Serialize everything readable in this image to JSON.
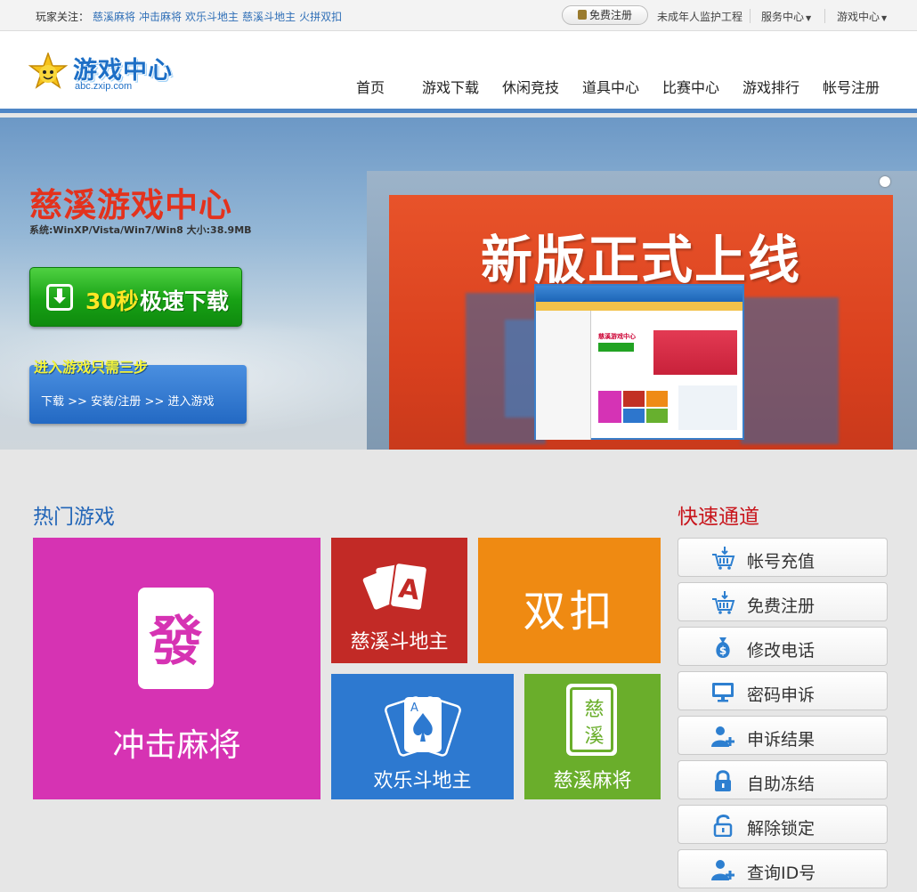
{
  "topbar": {
    "follow_label": "玩家关注：",
    "follow_links": [
      "慈溪麻将",
      "冲击麻将",
      "欢乐斗地主",
      "慈溪斗地主",
      "火拼双扣"
    ],
    "register_label": "免费注册",
    "guardian_label": "未成年人监护工程",
    "service_label": "服务中心",
    "game_center_label": "游戏中心"
  },
  "header": {
    "logo_title": "游戏中心",
    "logo_url": "abc.zxip.com",
    "nav": [
      "首页",
      "游戏下载",
      "休闲竞技",
      "道具中心",
      "比赛中心",
      "游戏排行",
      "帐号注册"
    ]
  },
  "banner": {
    "title": "慈溪游戏中心",
    "system_info": "系统:WinXP/Vista/Win7/Win8 大小:38.9MB",
    "download_num": "30秒",
    "download_text": "极速下载",
    "steps_title": "进入游戏只需三步",
    "steps_flow": "下载 >> 安装/注册 >> 进入游戏",
    "promo_title": "新版正式上线",
    "screen_title": "慈溪游戏中心"
  },
  "hot": {
    "title": "热门游戏",
    "tiles": {
      "mahjong": "冲击麻将",
      "mahjong_char": "發",
      "doudizhu": "慈溪斗地主",
      "doudizhu_card": "A",
      "shuangkou": "双扣",
      "huanle": "欢乐斗地主",
      "huanle_card": "A",
      "cixi_mj": "慈溪麻将",
      "cixi_char1": "慈",
      "cixi_char2": "溪"
    }
  },
  "quick": {
    "title": "快速通道",
    "items": [
      {
        "label": "帐号充值",
        "icon": "cart-icon"
      },
      {
        "label": "免费注册",
        "icon": "cart-icon"
      },
      {
        "label": "修改电话",
        "icon": "money-bag-icon"
      },
      {
        "label": "密码申诉",
        "icon": "monitor-icon"
      },
      {
        "label": "申诉结果",
        "icon": "user-add-icon"
      },
      {
        "label": "自助冻结",
        "icon": "lock-icon"
      },
      {
        "label": "解除锁定",
        "icon": "unlock-icon"
      },
      {
        "label": "查询ID号",
        "icon": "user-add-icon"
      }
    ]
  },
  "colors": {
    "accent_blue": "#2366b8",
    "quick_red": "#c8151c",
    "banner_red": "#e3321d",
    "icon_blue": "#2d7fd0"
  }
}
